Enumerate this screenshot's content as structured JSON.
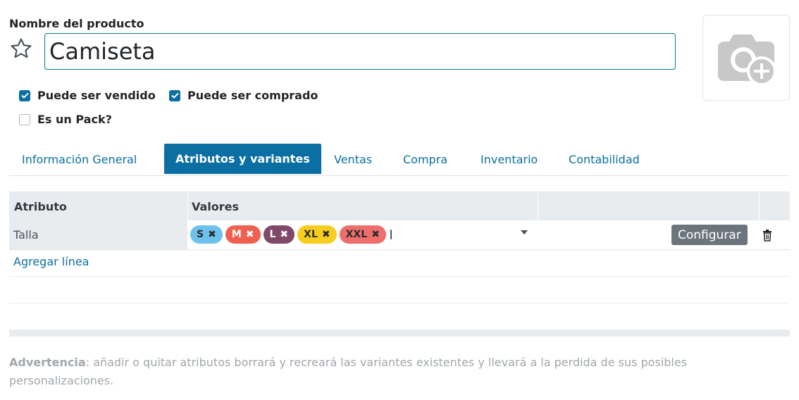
{
  "product": {
    "name_label": "Nombre del producto",
    "name_value": "Camiseta"
  },
  "checkboxes": [
    {
      "label": "Puede ser vendido",
      "checked": true
    },
    {
      "label": "Puede ser comprado",
      "checked": true
    },
    {
      "label": "Es un Pack?",
      "checked": false
    }
  ],
  "tabs": [
    {
      "label": "Información General",
      "active": false
    },
    {
      "label": "Atributos y variantes",
      "active": true
    },
    {
      "label": "Ventas",
      "active": false
    },
    {
      "label": "Compra",
      "active": false
    },
    {
      "label": "Inventario",
      "active": false
    },
    {
      "label": "Contabilidad",
      "active": false
    }
  ],
  "table": {
    "headers": [
      "Atributo",
      "Valores"
    ],
    "rows": [
      {
        "attribute": "Talla",
        "values": [
          {
            "label": "S",
            "color": "#6cc1ed"
          },
          {
            "label": "M",
            "color": "#f06050"
          },
          {
            "label": "L",
            "color": "#814968"
          },
          {
            "label": "XL",
            "color": "#f7cd1f"
          },
          {
            "label": "XXL",
            "color": "#ee6e6b"
          }
        ],
        "configure_label": "Configurar"
      }
    ],
    "add_line": "Agregar línea"
  },
  "warning": {
    "bold": "Advertencia",
    "text": ": añadir o quitar atributos borrará y recreará las variantes existentes y llevará a la perdida de sus posibles personalizaciones."
  },
  "colors": {
    "accent": "#0a6fa0",
    "active_tab": "#0b6fa3",
    "input_border": "#017e84"
  }
}
